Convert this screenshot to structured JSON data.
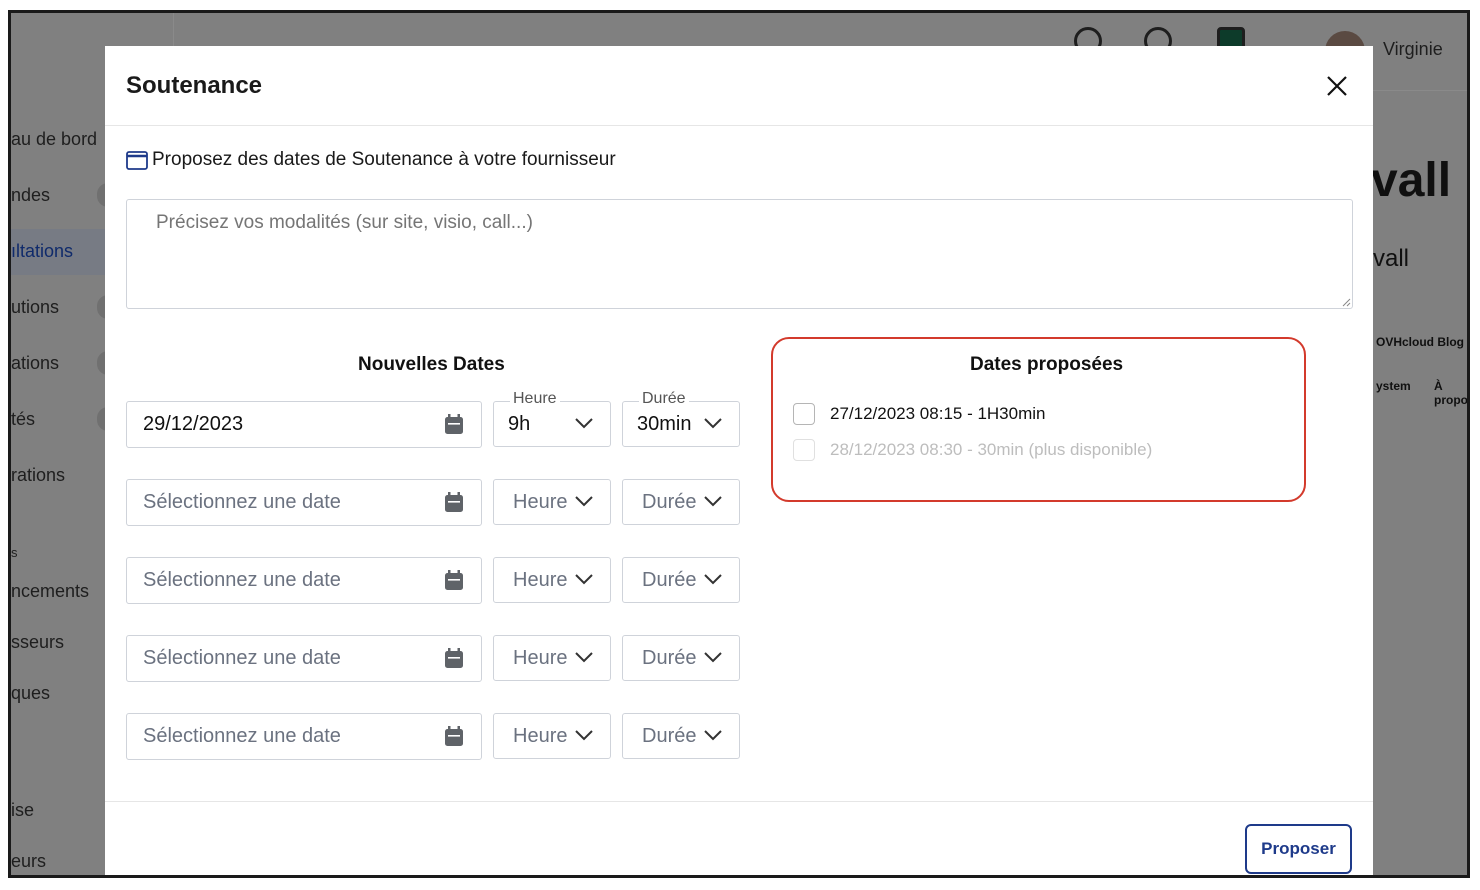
{
  "background": {
    "sidebar_items": [
      {
        "label": "au de bord"
      },
      {
        "label": "ndes"
      },
      {
        "label": "ıltations"
      },
      {
        "label": "utions"
      },
      {
        "label": "ations"
      },
      {
        "label": "tés"
      },
      {
        "label": "rations"
      },
      {
        "label": "s"
      },
      {
        "label": "ncements"
      },
      {
        "label": "sseurs"
      },
      {
        "label": "ques"
      },
      {
        "label": "ise"
      },
      {
        "label": "eurs"
      }
    ],
    "user_name": "Virginie",
    "main_title": "vall",
    "main_subtitle": "vall",
    "link_blog": "OVHcloud Blog",
    "link_system": "ystem",
    "link_about": "À propo"
  },
  "modal": {
    "title": "Soutenance",
    "intro": "Proposez des dates de Soutenance à votre fournisseur",
    "textarea_placeholder": "Précisez vos modalités (sur site, visio, call...)",
    "new_dates_title": "Nouvelles Dates",
    "proposed_dates_title": "Dates proposées",
    "heure_legend": "Heure",
    "duree_legend": "Durée",
    "rows": [
      {
        "date": "29/12/2023",
        "heure": "9h",
        "duree": "30min",
        "filled": true
      },
      {
        "date": "Sélectionnez une date",
        "heure": "Heure",
        "duree": "Durée",
        "filled": false
      },
      {
        "date": "Sélectionnez une date",
        "heure": "Heure",
        "duree": "Durée",
        "filled": false
      },
      {
        "date": "Sélectionnez une date",
        "heure": "Heure",
        "duree": "Durée",
        "filled": false
      },
      {
        "date": "Sélectionnez une date",
        "heure": "Heure",
        "duree": "Durée",
        "filled": false
      }
    ],
    "proposed": [
      {
        "label": "27/12/2023 08:15 - 1H30min",
        "disabled": false
      },
      {
        "label": "28/12/2023 08:30 - 30min (plus disponible)",
        "disabled": true
      }
    ],
    "submit_label": "Proposer"
  },
  "colors": {
    "accent": "#1e3a8a",
    "highlight_border": "#d33a2c"
  }
}
